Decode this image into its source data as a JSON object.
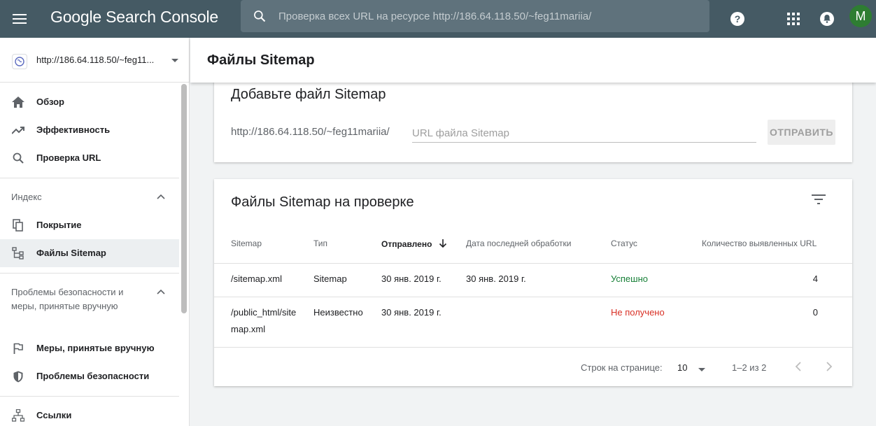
{
  "topbar": {
    "logo": "Google Search Console",
    "search_placeholder": "Проверка всех URL на ресурсе http://186.64.118.50/~feg11mariia/",
    "avatar_letter": "M",
    "bg_color": "#455a64"
  },
  "sidebar": {
    "property": "http://186.64.118.50/~feg11...",
    "items": [
      {
        "label": "Обзор",
        "icon": "home-icon"
      },
      {
        "label": "Эффективность",
        "icon": "trending-up-icon"
      },
      {
        "label": "Проверка URL",
        "icon": "search-icon"
      }
    ],
    "index_section": {
      "title": "Индекс",
      "items": [
        {
          "label": "Покрытие",
          "icon": "copy-icon"
        },
        {
          "label": "Файлы Sitemap",
          "icon": "sitemap-icon",
          "active": true
        }
      ]
    },
    "security_section": {
      "title": "Проблемы безопасности и меры, принятые вручную",
      "items": [
        {
          "label": "Меры, принятые вручную",
          "icon": "flag-icon"
        },
        {
          "label": "Проблемы безопасности",
          "icon": "shield-icon"
        }
      ]
    },
    "links_item": {
      "label": "Ссылки",
      "icon": "links-icon"
    }
  },
  "main": {
    "page_title": "Файлы Sitemap",
    "add_card": {
      "title": "Добавьте файл Sitemap",
      "prefix": "http://186.64.118.50/~feg11mariia/",
      "input_placeholder": "URL файла Sitemap",
      "submit_label": "ОТПРАВИТЬ"
    },
    "submitted_card": {
      "title": "Файлы Sitemap на проверке",
      "columns": [
        "Sitemap",
        "Тип",
        "Отправлено",
        "Дата последней обработки",
        "Статус",
        "Количество выявленных URL"
      ],
      "rows": [
        {
          "sitemap": "/sitemap.xml",
          "type": "Sitemap",
          "submitted": "30 янв. 2019 г.",
          "last_read": "30 янв. 2019 г.",
          "status": "Успешно",
          "status_color": "#188038",
          "urls": "4"
        },
        {
          "sitemap": "/public_html/sitemap.xml",
          "type": "Неизвестно",
          "submitted": "30 янв. 2019 г.",
          "last_read": "",
          "status": "Не получено",
          "status_color": "#d93025",
          "urls": "0"
        }
      ],
      "pager": {
        "rows_per_page_label": "Строк на странице:",
        "rows_per_page": "10",
        "range": "1–2 из 2"
      }
    }
  }
}
